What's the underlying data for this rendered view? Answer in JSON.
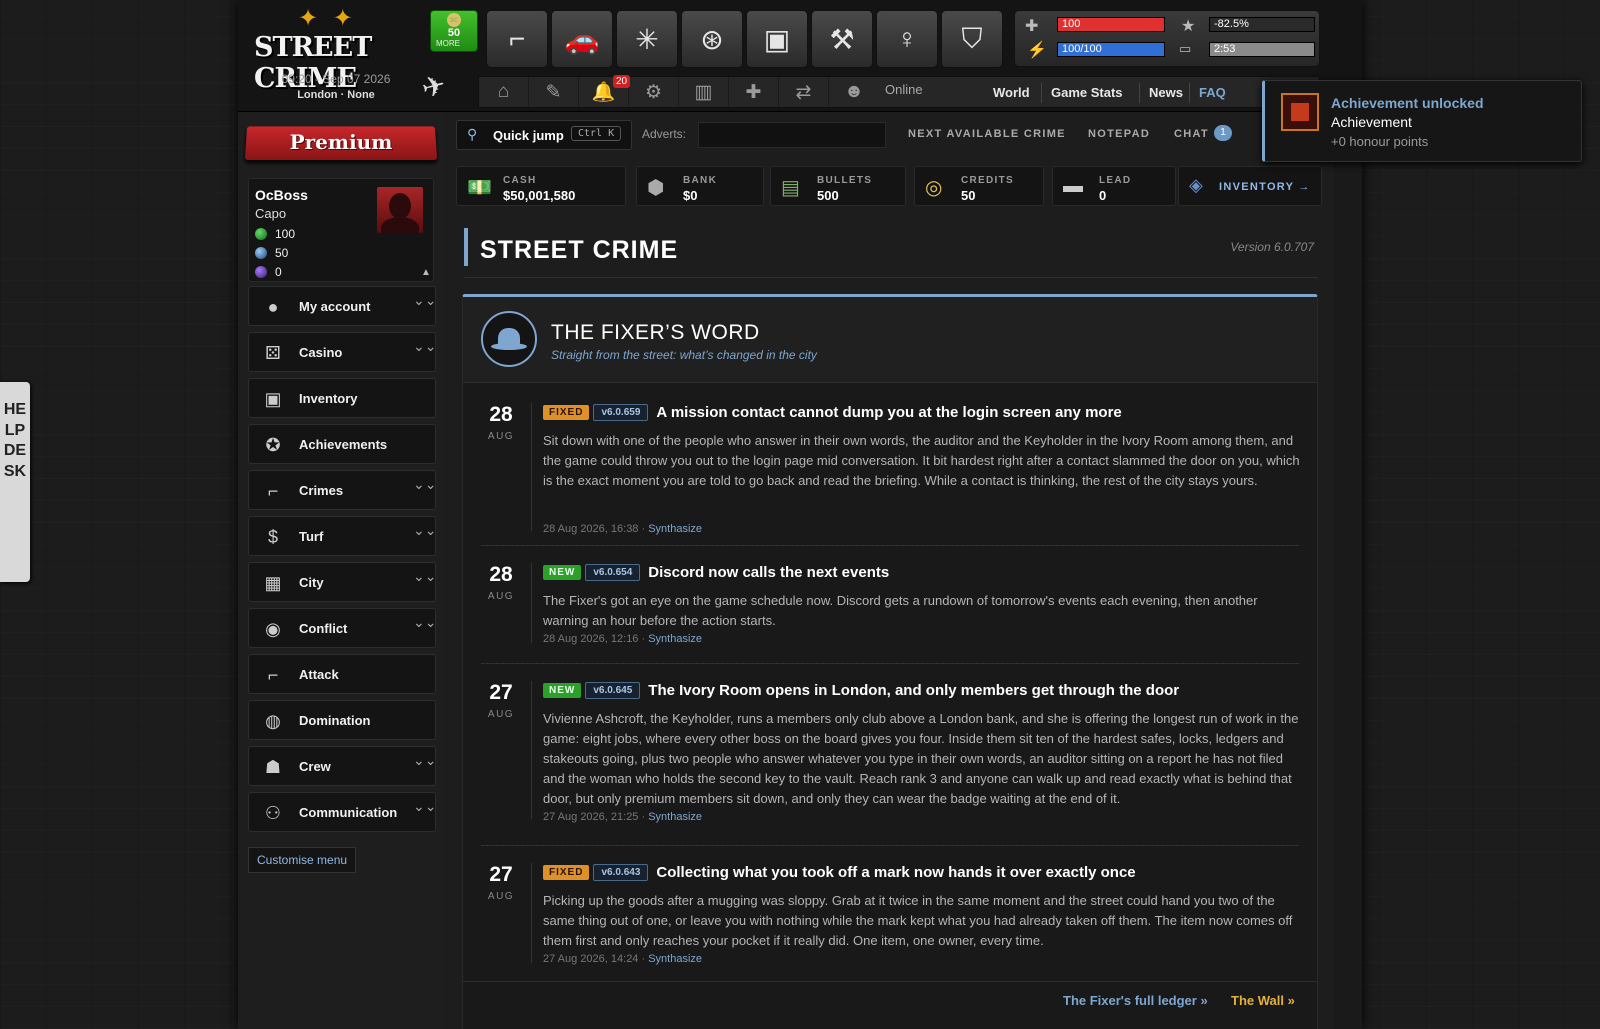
{
  "header": {
    "logo_figures": "✦ ✦",
    "logo_title": "STREET CRIME",
    "datetime": "09:20 - Sep 07 2026",
    "location": "London · None",
    "more_button": {
      "count": "50",
      "label": "MORE",
      "coin": "sc"
    },
    "crime_icons": [
      {
        "name": "gun-icon",
        "glyph": "⌐"
      },
      {
        "name": "car-icon",
        "glyph": "🚗"
      },
      {
        "name": "leaf-icon",
        "glyph": "✳"
      },
      {
        "name": "steering-wheel-icon",
        "glyph": "⊛"
      },
      {
        "name": "briefcase-icon",
        "glyph": "▣"
      },
      {
        "name": "dumbbell-icon",
        "glyph": "⚒"
      },
      {
        "name": "pole-dancer-icon",
        "glyph": "♀"
      },
      {
        "name": "basket-icon",
        "glyph": "⛉"
      }
    ],
    "stats": {
      "health": "100",
      "health_fill": 1.0,
      "energy": "100/100",
      "energy_fill": 1.0,
      "rank_progress": "-82.5%",
      "timer": "2:53"
    },
    "subnav": {
      "notification_count": "20",
      "online_label": "Online",
      "links": [
        "World",
        "Game Stats",
        "News",
        "FAQ"
      ]
    }
  },
  "sidebar": {
    "premium_label": "Premium",
    "profile": {
      "name": "OcBoss",
      "rank": "Capo",
      "stats": [
        "100",
        "50",
        "0"
      ]
    },
    "menu": [
      {
        "label": "My account",
        "icon": "user-icon",
        "glyph": "●",
        "chevron": true
      },
      {
        "label": "Casino",
        "icon": "dice-icon",
        "glyph": "⚄",
        "chevron": true
      },
      {
        "label": "Inventory",
        "icon": "briefcase-icon",
        "glyph": "▣",
        "chevron": false
      },
      {
        "label": "Achievements",
        "icon": "medal-icon",
        "glyph": "✪",
        "chevron": false
      },
      {
        "label": "Crimes",
        "icon": "uzi-icon",
        "glyph": "⌐",
        "chevron": true
      },
      {
        "label": "Turf",
        "icon": "dollar-icon",
        "glyph": "$",
        "chevron": true
      },
      {
        "label": "City",
        "icon": "building-icon",
        "glyph": "▦",
        "chevron": true
      },
      {
        "label": "Conflict",
        "icon": "target-icon",
        "glyph": "◉",
        "chevron": true
      },
      {
        "label": "Attack",
        "icon": "pistol-icon",
        "glyph": "⌐",
        "chevron": false
      },
      {
        "label": "Domination",
        "icon": "globe-icon",
        "glyph": "◍",
        "chevron": false
      },
      {
        "label": "Crew",
        "icon": "crew-icon",
        "glyph": "☗",
        "chevron": true
      },
      {
        "label": "Communication",
        "icon": "people-icon",
        "glyph": "⚇",
        "chevron": true
      }
    ],
    "customise_label": "Customise menu"
  },
  "toolbar": {
    "quick_jump": "Quick jump",
    "shortcut": "Ctrl K",
    "adverts_label": "Adverts:",
    "links": [
      "NEXT AVAILABLE CRIME",
      "NOTEPAD",
      "CHAT"
    ],
    "chat_count": "1"
  },
  "currencies": [
    {
      "label": "CASH",
      "value": "$50,001,580",
      "icon": "cash-icon",
      "glyph": "💵"
    },
    {
      "label": "BANK",
      "value": "$0",
      "icon": "bank-icon",
      "glyph": "⬢"
    },
    {
      "label": "BULLETS",
      "value": "500",
      "icon": "bullets-icon",
      "glyph": "▤"
    },
    {
      "label": "CREDITS",
      "value": "50",
      "icon": "credits-icon",
      "glyph": "◎"
    },
    {
      "label": "LEAD",
      "value": "0",
      "icon": "lead-icon",
      "glyph": "▬"
    }
  ],
  "inventory_link": "INVENTORY →",
  "page": {
    "title": "STREET CRIME",
    "version": "Version 6.0.707"
  },
  "fixer": {
    "title": "THE FIXER’S WORD",
    "subtitle": "Straight from the street: what’s changed in the city",
    "entries": [
      {
        "day": "28",
        "month": "AUG",
        "tag": "FIXED",
        "version": "v6.0.659",
        "title": "A mission contact cannot dump you at the login screen any more",
        "body": "Sit down with one of the people who answer in their own words, the auditor and the Keyholder in the Ivory Room among them, and the game could throw you out to the login page mid conversation. It bit hardest right after a contact slammed the door on you, which is the exact moment you are told to go back and read the briefing. While a contact is thinking, the rest of the city stays yours.",
        "date": "28 Aug 2026, 16:38",
        "author": "Synthasize"
      },
      {
        "day": "28",
        "month": "AUG",
        "tag": "NEW",
        "version": "v6.0.654",
        "title": "Discord now calls the next events",
        "body": "The Fixer's got an eye on the game schedule now. Discord gets a rundown of tomorrow's events each evening, then another warning an hour before the action starts.",
        "date": "28 Aug 2026, 12:16",
        "author": "Synthasize"
      },
      {
        "day": "27",
        "month": "AUG",
        "tag": "NEW",
        "version": "v6.0.645",
        "title": "The Ivory Room opens in London, and only members get through the door",
        "body": "Vivienne Ashcroft, the Keyholder, runs a members only club above a London bank, and she is offering the longest run of work in the game: eight jobs, where every other boss on the board gives you four. Inside them sit ten of the hardest safes, locks, ledgers and stakeouts going, plus two people who answer whatever you type in their own words, an auditor sitting on a report he has not filed and the woman who holds the second key to the vault. Reach rank 3 and anyone can walk up and read exactly what is behind that door, but only premium members sit down, and only they can wear the badge waiting at the end of it.",
        "date": "27 Aug 2026, 21:25",
        "author": "Synthasize"
      },
      {
        "day": "27",
        "month": "AUG",
        "tag": "FIXED",
        "version": "v6.0.643",
        "title": "Collecting what you took off a mark now hands it over exactly once",
        "body": "Picking up the goods after a mugging was sloppy. Grab at it twice in the same moment and the street could hand you two of the same thing out of one, or leave you with nothing while the mark kept what you had already taken off them. The item now comes off them first and only reaches your pocket if it really did. One item, one owner, every time.",
        "date": "27 Aug 2026, 14:24",
        "author": "Synthasize"
      }
    ],
    "ledger_link": "The Fixer's full ledger »",
    "wall_link": "The Wall »"
  },
  "toast": {
    "title": "Achievement unlocked",
    "name": "Achievement",
    "points": "+0 honour points"
  },
  "helpdesk": "HELPDESK",
  "colors": {
    "accent": "#7ea6cf",
    "fixed": "#e0902a",
    "new": "#2ba12b",
    "health": "#e03030",
    "energy": "#2f6fd6"
  }
}
